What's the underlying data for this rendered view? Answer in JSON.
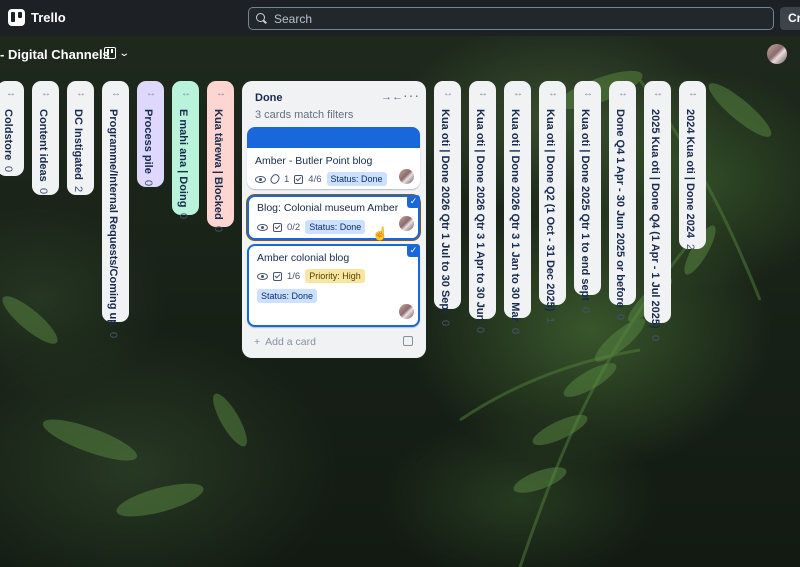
{
  "topbar": {
    "app_name": "Trello",
    "search_placeholder": "Search",
    "create_label": "Cre"
  },
  "board": {
    "title": "- Digital Channels"
  },
  "collapsed_lists_left": [
    {
      "name": "Coldstore",
      "count": "0",
      "color": "#f1f2f4"
    },
    {
      "name": "Content ideas",
      "count": "0",
      "color": "#f1f2f4"
    },
    {
      "name": "DC Instigated",
      "count": "2",
      "color": "#f1f2f4"
    },
    {
      "name": "Programme/Internal Requests/Coming up",
      "count": "0",
      "color": "#f1f2f4"
    },
    {
      "name": "Process pile",
      "count": "0",
      "color": "#dfd8fd"
    },
    {
      "name": "E mahi ana | Doing",
      "count": "0",
      "color": "#baf3db"
    },
    {
      "name": "Kua tārewa | Blocked",
      "count": "0",
      "color": "#ffd5d2"
    }
  ],
  "done_list": {
    "title": "Done",
    "filter_text": "3 cards match filters",
    "add_card_label": "Add a card",
    "cards": [
      {
        "title": "Amber - Butler Point blog",
        "attachments": "1",
        "checklist": "4/6",
        "labels": [
          "Status: Done"
        ]
      },
      {
        "title": "Blog: Colonial museum Amber",
        "checklist": "0/2",
        "labels": [
          "Status: Done"
        ]
      },
      {
        "title": "Amber colonial blog",
        "checklist": "1/6",
        "labels": [
          "Priority: High",
          "Status: Done"
        ]
      }
    ]
  },
  "collapsed_lists_right": [
    {
      "name": "Kua oti | Done 2026 Qtr 1 Jul to 30 Sept",
      "count": "0"
    },
    {
      "name": "Kua oti | Done 2026 Qtr 3 1 Apr to 30 Jun",
      "count": "0"
    },
    {
      "name": "Kua oti | Done 2026 Qtr 3 1 Jan to 30 Mar",
      "count": "0"
    },
    {
      "name": "Kua oti | Done Q2 (1 Oct - 31 Dec 2025)",
      "count": "1"
    },
    {
      "name": "Kua oti | Done 2025 Qtr 1 to end sept",
      "count": "0"
    },
    {
      "name": "Done Q4 1 Apr - 30 Jun 2025 or before",
      "count": "0"
    },
    {
      "name": "2025 Kua oti | Done Q4 (1 Apr - 1 Jul 2025)",
      "count": "0"
    },
    {
      "name": "2024 Kua oti | Done 2024",
      "count": "2"
    }
  ],
  "icons": {
    "expand": "↔",
    "collapse": "→←",
    "more": "···",
    "check": "✓",
    "plus": "+",
    "cursor": "☝",
    "chevron": "⌄"
  },
  "colors": {
    "accent": "#1868db",
    "topbar_bg": "#1d2125",
    "list_bg": "#f1f2f4"
  }
}
